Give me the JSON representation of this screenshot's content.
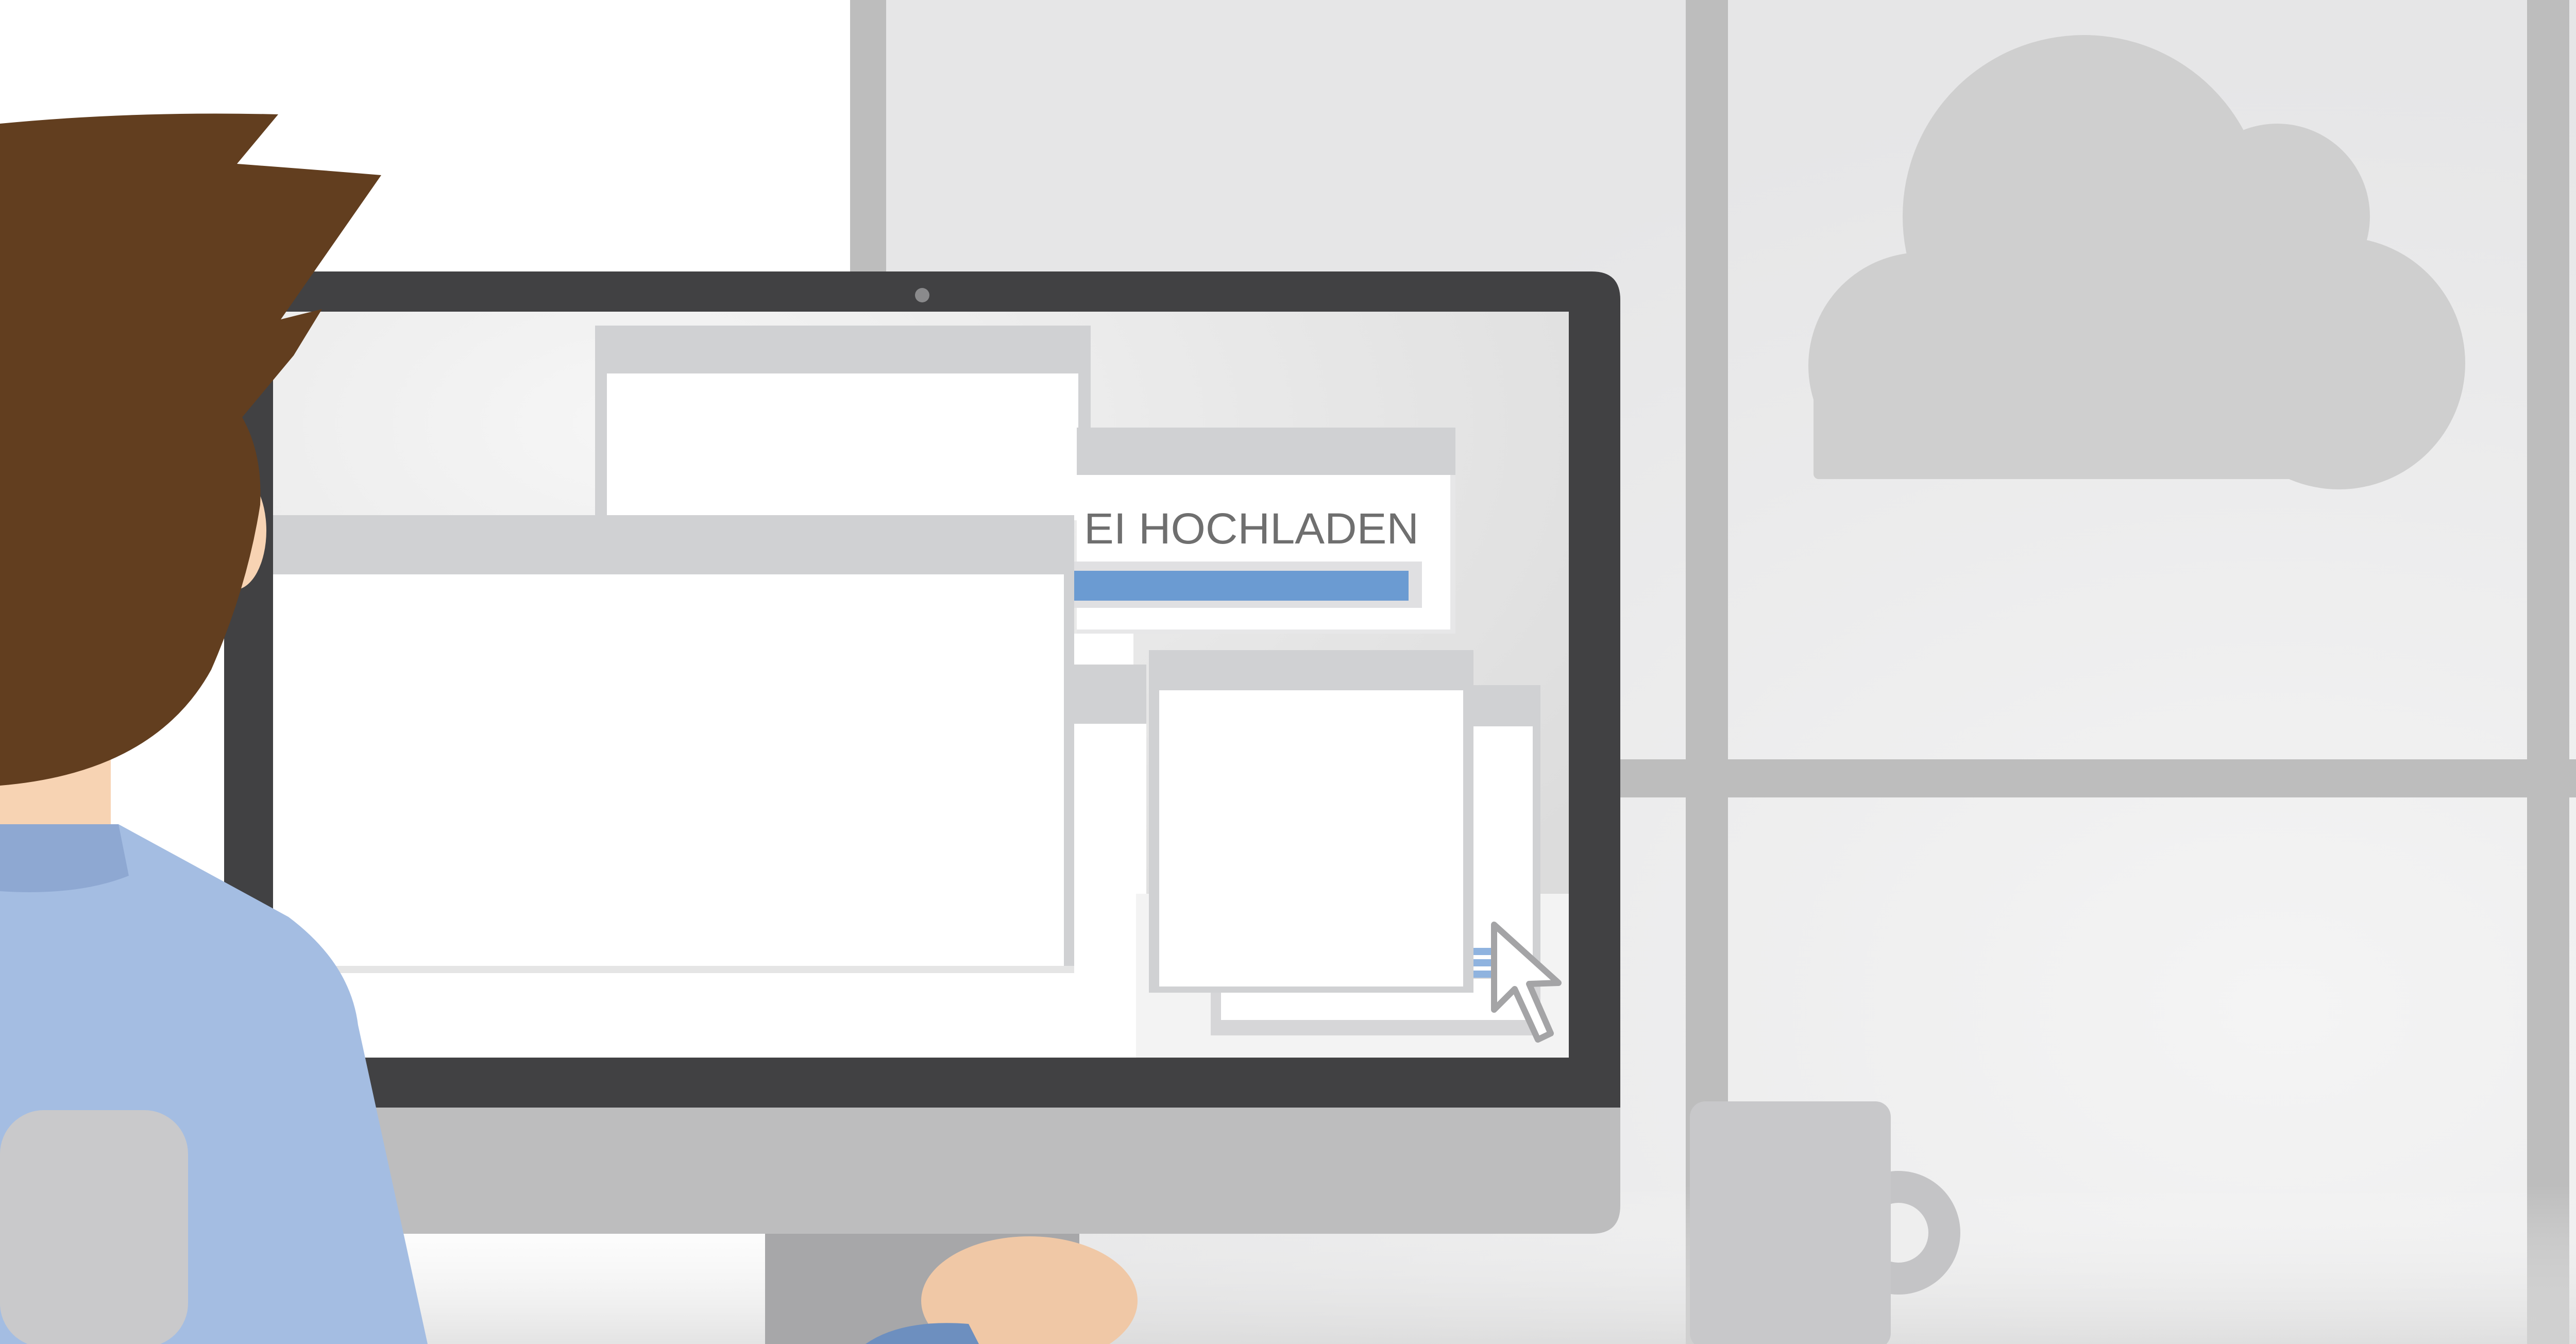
{
  "scene": {
    "upload_dialog": {
      "label": "EI HOCHLADEN",
      "progress_fraction": 0.97
    },
    "colors": {
      "wall": "#ebebec",
      "window_frame": "#bdbdbd",
      "cloud": "#cfcfcf",
      "monitor_bezel": "#414143",
      "monitor_chin": "#bdbdbe",
      "screen_bg": "#e4e4e4",
      "window_titlebar": "#d0d1d3",
      "window_body": "#ffffff",
      "progress_fill": "#6b9bd2",
      "hair": "#623e1f",
      "skin": "#f7d3b3",
      "shirt": "#a4bde2",
      "chair": "#c9c9cb",
      "mug": "#c8c8ca"
    },
    "icons": {
      "cloud": "cloud-icon",
      "cursor": "arrow-cursor-icon",
      "camera": "webcam-dot-icon"
    }
  }
}
